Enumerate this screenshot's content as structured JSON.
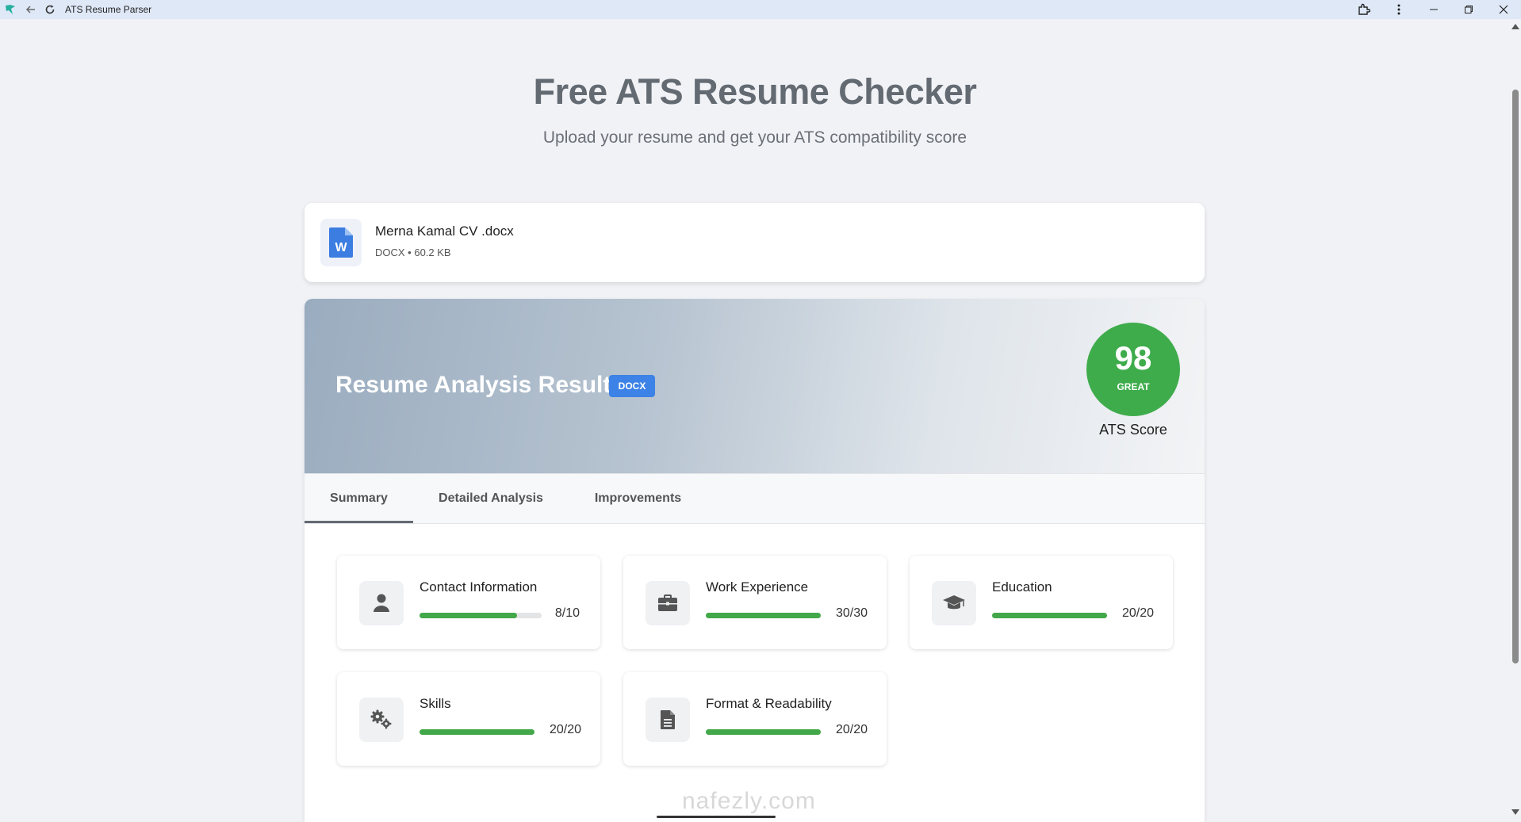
{
  "window": {
    "title": "ATS Resume Parser"
  },
  "page": {
    "title": "Free ATS Resume Checker",
    "subtitle": "Upload your resume and get your ATS compatibility score"
  },
  "file": {
    "name": "Merna Kamal CV .docx",
    "meta": "DOCX • 60.2 KB",
    "icon": "word-document-icon"
  },
  "results": {
    "title": "Resume Analysis Results",
    "badge": "DOCX",
    "score": "98",
    "grade": "GREAT",
    "score_label": "ATS Score",
    "score_color": "#3fac4c"
  },
  "tabs": [
    {
      "label": "Summary",
      "active": true
    },
    {
      "label": "Detailed Analysis",
      "active": false
    },
    {
      "label": "Improvements",
      "active": false
    }
  ],
  "sections": [
    {
      "title": "Contact Information",
      "score": "8/10",
      "fraction": 0.8,
      "icon": "person-icon"
    },
    {
      "title": "Work Experience",
      "score": "30/30",
      "fraction": 1.0,
      "icon": "briefcase-icon"
    },
    {
      "title": "Education",
      "score": "20/20",
      "fraction": 1.0,
      "icon": "graduation-cap-icon"
    },
    {
      "title": "Skills",
      "score": "20/20",
      "fraction": 1.0,
      "icon": "gears-icon"
    },
    {
      "title": "Format & Readability",
      "score": "20/20",
      "fraction": 1.0,
      "icon": "document-icon"
    }
  ],
  "watermark": "nafezly.com"
}
